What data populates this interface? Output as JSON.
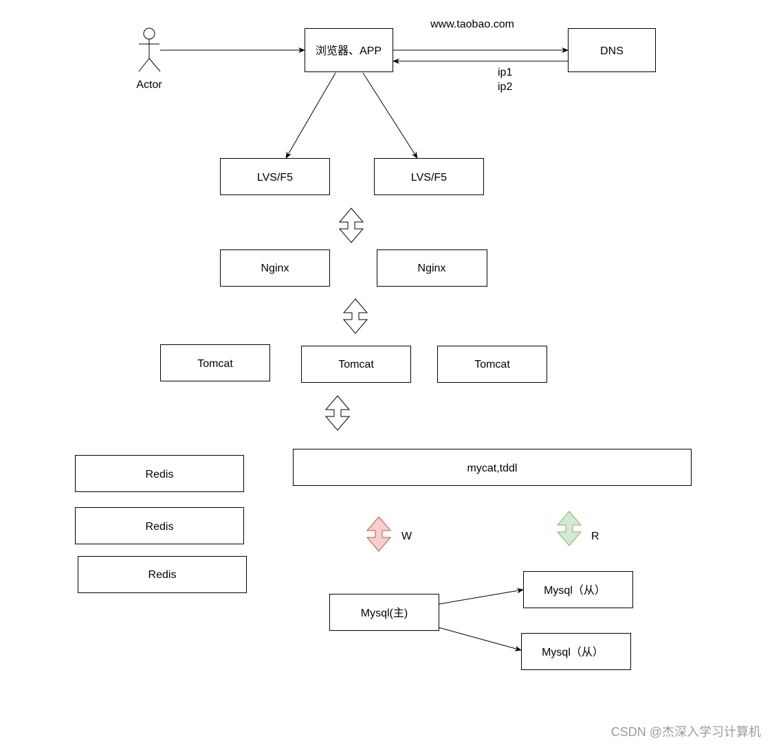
{
  "actor": {
    "label": "Actor"
  },
  "nodes": {
    "browser": "浏览器、APP",
    "dns": "DNS",
    "lvs1": "LVS/F5",
    "lvs2": "LVS/F5",
    "nginx1": "Nginx",
    "nginx2": "Nginx",
    "tomcat1": "Tomcat",
    "tomcat2": "Tomcat",
    "tomcat3": "Tomcat",
    "redis1": "Redis",
    "redis2": "Redis",
    "redis3": "Redis",
    "mycat": "mycat,tddl",
    "mysql_master": "Mysql(主)",
    "mysql_slave1": "Mysql（从）",
    "mysql_slave2": "Mysql（从）"
  },
  "edge_labels": {
    "dns_query": "www.taobao.com",
    "ip1": "ip1",
    "ip2": "ip2",
    "write": "W",
    "read": "R"
  },
  "colors": {
    "write_fill": "#f8cecc",
    "write_stroke": "#b85450",
    "read_fill": "#d5e8d4",
    "read_stroke": "#82b366"
  },
  "watermark": "CSDN @杰深入学习计算机"
}
